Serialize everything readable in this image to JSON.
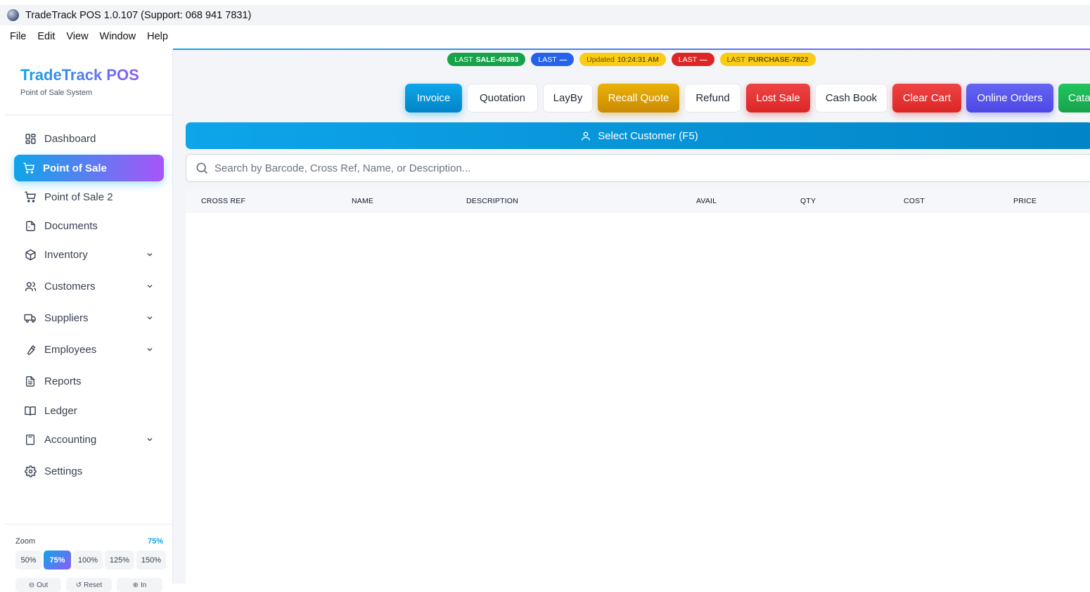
{
  "window": {
    "title": "TradeTrack POS 1.0.107 (Support: 068 941 7831)"
  },
  "menu": [
    "File",
    "Edit",
    "View",
    "Window",
    "Help"
  ],
  "brand": {
    "title": "TradeTrack POS",
    "subtitle": "Point of Sale System"
  },
  "sidebar": {
    "items": [
      {
        "label": "Dashboard",
        "icon": "dashboard-icon",
        "expandable": false,
        "active": false
      },
      {
        "label": "Point of Sale",
        "icon": "cart-icon",
        "expandable": false,
        "active": true
      },
      {
        "label": "Point of Sale 2",
        "icon": "cart-icon",
        "expandable": false,
        "active": false
      },
      {
        "label": "Documents",
        "icon": "documents-icon",
        "expandable": false,
        "active": false
      },
      {
        "label": "Inventory",
        "icon": "box-icon",
        "expandable": true,
        "active": false
      },
      {
        "label": "Customers",
        "icon": "users-icon",
        "expandable": true,
        "active": false
      },
      {
        "label": "Suppliers",
        "icon": "truck-icon",
        "expandable": true,
        "active": false
      },
      {
        "label": "Employees",
        "icon": "wrench-icon",
        "expandable": true,
        "active": false
      },
      {
        "label": "Reports",
        "icon": "report-icon",
        "expandable": false,
        "active": false
      },
      {
        "label": "Ledger",
        "icon": "book-icon",
        "expandable": false,
        "active": false
      },
      {
        "label": "Accounting",
        "icon": "calculator-icon",
        "expandable": true,
        "active": false
      },
      {
        "label": "Settings",
        "icon": "gear-icon",
        "expandable": false,
        "active": false
      }
    ]
  },
  "zoom": {
    "label": "Zoom",
    "current": "75%",
    "options": [
      "50%",
      "75%",
      "100%",
      "125%",
      "150%"
    ],
    "controls": [
      "Out",
      "Reset",
      "In"
    ]
  },
  "status_pills": [
    {
      "prefix": "LAST",
      "value": "SALE-49393",
      "color": "#16a34a"
    },
    {
      "prefix": "LAST",
      "value": "—",
      "color": "#2563eb"
    },
    {
      "prefix": "Updated",
      "value": "10:24:31 AM",
      "color": "#facc15"
    },
    {
      "prefix": "LAST",
      "value": "—",
      "color": "#dc2626"
    },
    {
      "prefix": "LAST",
      "value": "PURCHASE-7822",
      "color": "#facc15"
    }
  ],
  "actions": {
    "invoice": "Invoice",
    "quotation": "Quotation",
    "layby": "LayBy",
    "recall_quote": "Recall Quote",
    "refund": "Refund",
    "lost_sale": "Lost Sale",
    "cash_book": "Cash Book",
    "clear_cart": "Clear Cart",
    "online_orders": "Online Orders",
    "catalog": "Cata"
  },
  "customer": {
    "label": "Select Customer (F5)"
  },
  "search": {
    "placeholder": "Search by Barcode, Cross Ref, Name, or Description...",
    "value": ""
  },
  "table": {
    "columns": [
      "CROSS REF",
      "NAME",
      "DESCRIPTION",
      "AVAIL",
      "QTY",
      "COST",
      "PRICE"
    ],
    "rows": []
  }
}
